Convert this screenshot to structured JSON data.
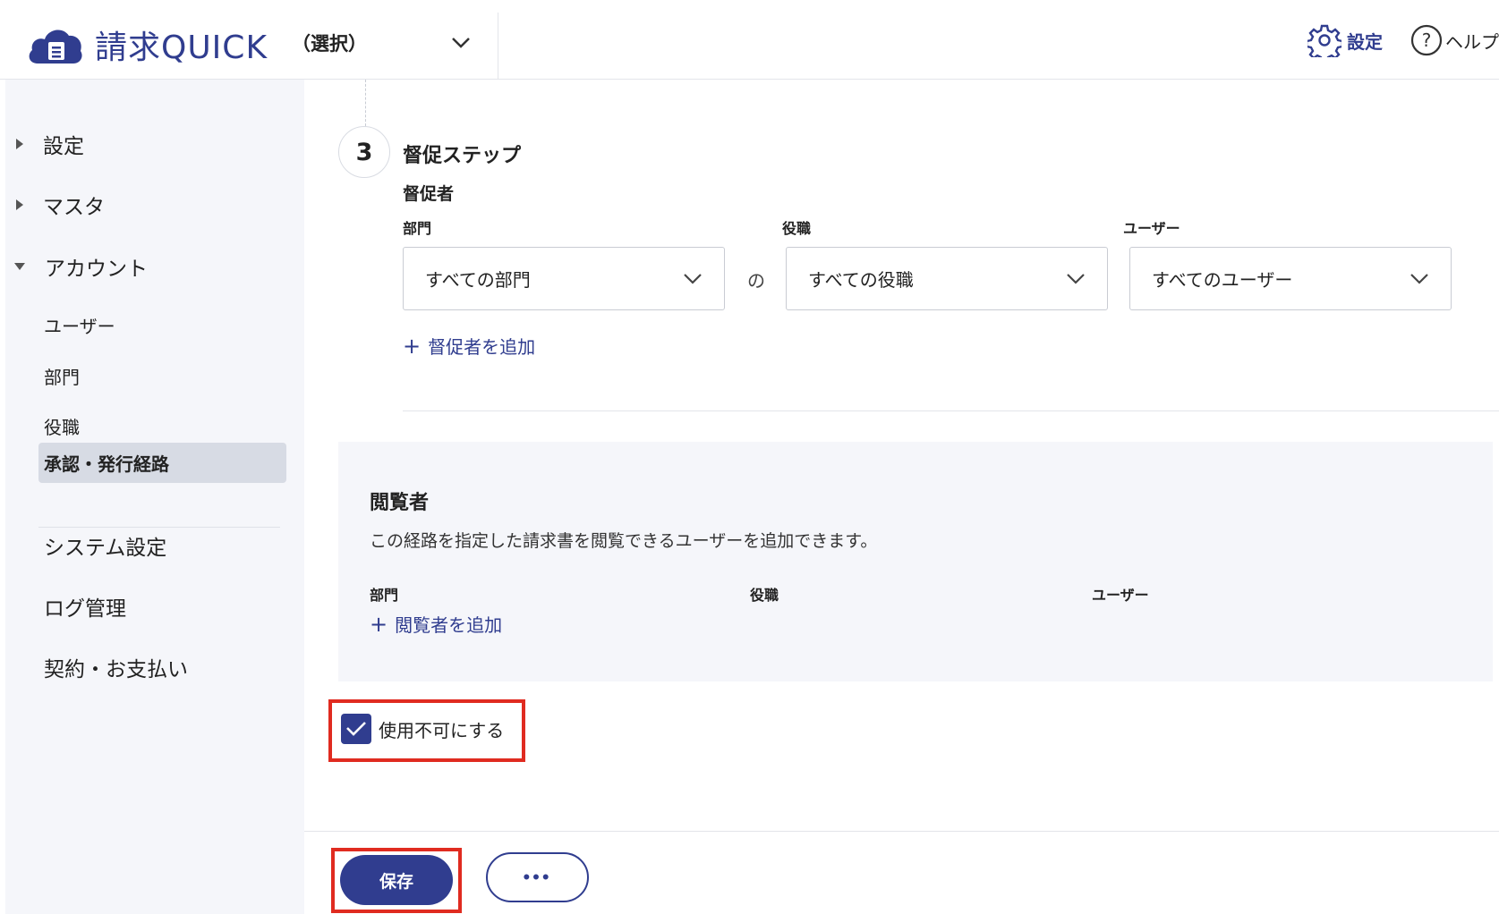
{
  "header": {
    "app_name": "請求QUICK",
    "company_select": "（選択）",
    "settings_label": "設定",
    "help_label": "ヘルプ"
  },
  "sidebar": {
    "groups": [
      {
        "label": "設定",
        "expanded": false
      },
      {
        "label": "マスタ",
        "expanded": false
      },
      {
        "label": "アカウント",
        "expanded": true
      }
    ],
    "account_items": [
      {
        "label": "ユーザー"
      },
      {
        "label": "部門"
      },
      {
        "label": "役職"
      },
      {
        "label": "承認・発行経路",
        "active": true
      }
    ],
    "other_items": [
      {
        "label": "システム設定"
      },
      {
        "label": "ログ管理"
      },
      {
        "label": "契約・お支払い"
      }
    ]
  },
  "step": {
    "number": "3",
    "title": "督促ステップ",
    "section_label": "督促者",
    "department_label": "部門",
    "position_label": "役職",
    "user_label": "ユーザー",
    "department_value": "すべての部門",
    "connector": "の",
    "position_value": "すべての役職",
    "user_value": "すべてのユーザー",
    "add_label": "督促者を追加"
  },
  "viewer": {
    "title": "閲覧者",
    "description": "この経路を指定した請求書を閲覧できるユーザーを追加できます。",
    "department_label": "部門",
    "position_label": "役職",
    "user_label": "ユーザー",
    "add_label": "閲覧者を追加"
  },
  "disable": {
    "label": "使用不可にする",
    "checked": true
  },
  "footer": {
    "save_label": "保存",
    "more_label": "•••"
  },
  "colors": {
    "primary": "#303d8f",
    "highlight": "#e02b20",
    "sidebar_bg": "#f5f6fa",
    "active_item_bg": "#d7dbe4"
  }
}
